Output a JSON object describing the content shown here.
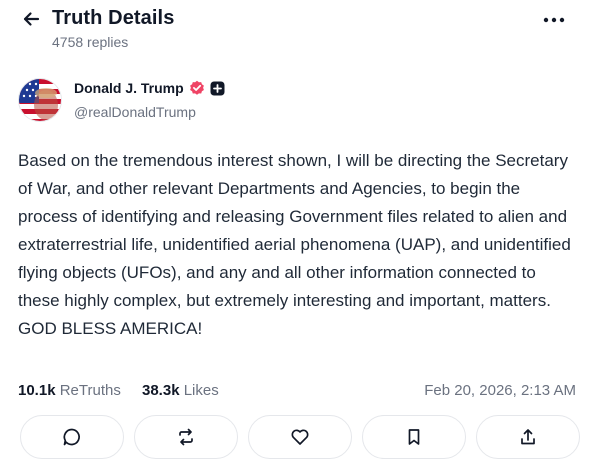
{
  "header": {
    "title": "Truth Details",
    "replies": "4758 replies",
    "back_icon": "arrow-left-icon",
    "more_icon": "more-horizontal-icon"
  },
  "post": {
    "author": {
      "name": "Donald J. Trump",
      "handle": "@realDonaldTrump",
      "verified_color": "#ef4465"
    },
    "text": "Based on the tremendous interest shown, I will be directing the Secretary of War, and other relevant Departments and Agencies, to begin the process of identifying and releasing Government files related to alien and extraterrestrial life, unidentified aerial phenomena (UAP), and unidentified flying objects (UFOs), and any and all other information connected to these highly complex, but extremely interesting and important, matters. GOD BLESS AMERICA!",
    "stats": {
      "retruths_count": "10.1k",
      "retruths_label": "ReTruths",
      "likes_count": "38.3k",
      "likes_label": "Likes"
    },
    "timestamp": "Feb 20, 2026, 2:13 AM"
  },
  "actions": [
    {
      "name": "reply",
      "icon": "comment-icon"
    },
    {
      "name": "retruth",
      "icon": "retruth-icon"
    },
    {
      "name": "like",
      "icon": "heart-icon"
    },
    {
      "name": "bookmark",
      "icon": "bookmark-icon"
    },
    {
      "name": "share",
      "icon": "share-icon"
    }
  ]
}
